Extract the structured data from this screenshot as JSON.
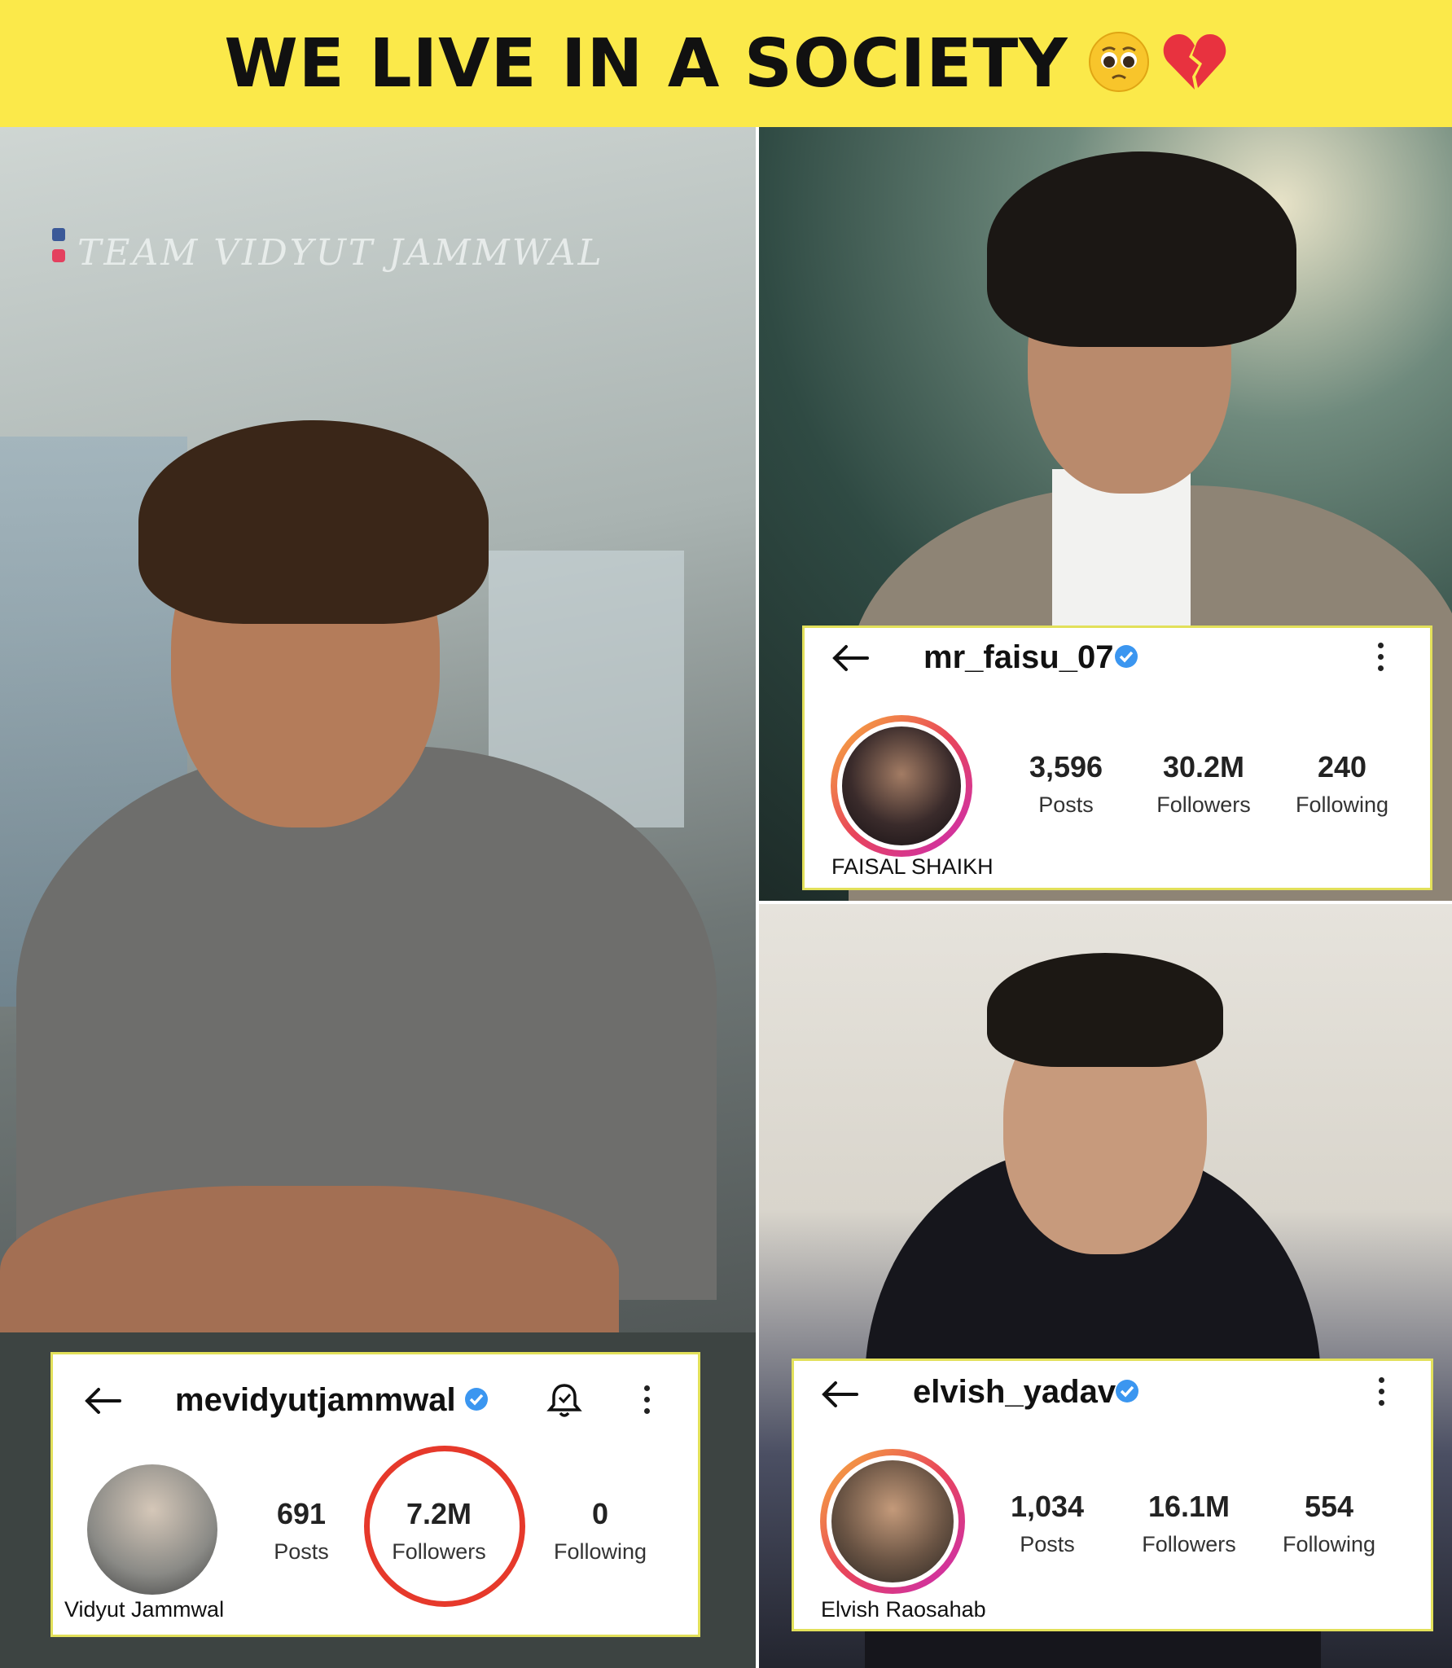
{
  "banner": {
    "title": "WE LIVE IN A SOCIETY",
    "emojis": [
      "pleading-face-icon",
      "broken-heart-icon"
    ],
    "background": "#fbe94a"
  },
  "watermark": {
    "text": "TEAM VIDYUT JAMMWAL",
    "icons": [
      "facebook-icon",
      "instagram-icon"
    ]
  },
  "profiles": {
    "vidyut": {
      "username": "mevidyutjammwal",
      "display_name": "Vidyut Jammwal",
      "verified": true,
      "has_notification_bell": true,
      "stats": {
        "posts": "691",
        "posts_label": "Posts",
        "followers": "7.2M",
        "followers_label": "Followers",
        "following": "0",
        "following_label": "Following"
      },
      "followers_highlighted": true,
      "highlight_color": "#e6392b"
    },
    "faisu": {
      "username": "mr_faisu_07",
      "display_name": "FAISAL SHAIKH",
      "verified": true,
      "stats": {
        "posts": "3,596",
        "posts_label": "Posts",
        "followers": "30.2M",
        "followers_label": "Followers",
        "following": "240",
        "following_label": "Following"
      }
    },
    "elvish": {
      "username": "elvish_yadav",
      "display_name": "Elvish Raosahab",
      "verified": true,
      "stats": {
        "posts": "1,034",
        "posts_label": "Posts",
        "followers": "16.1M",
        "followers_label": "Followers",
        "following": "554",
        "following_label": "Following"
      }
    }
  },
  "colors": {
    "verified_blue": "#3b96f0",
    "story_ring_start": "#f7b33d",
    "story_ring_end": "#c92bb7",
    "card_border": "#e2e05a"
  }
}
